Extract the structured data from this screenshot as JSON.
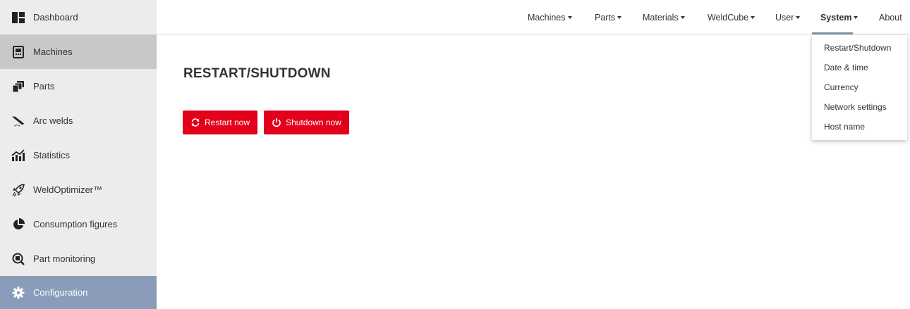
{
  "sidebar": {
    "items": [
      {
        "label": "Dashboard",
        "icon": "dashboard-icon"
      },
      {
        "label": "Machines",
        "icon": "machine-icon"
      },
      {
        "label": "Parts",
        "icon": "parts-icon"
      },
      {
        "label": "Arc welds",
        "icon": "arc-weld-icon"
      },
      {
        "label": "Statistics",
        "icon": "statistics-icon"
      },
      {
        "label": "WeldOptimizer™",
        "icon": "rocket-icon"
      },
      {
        "label": "Consumption figures",
        "icon": "pie-chart-icon"
      },
      {
        "label": "Part monitoring",
        "icon": "search-monitor-icon"
      },
      {
        "label": "Configuration",
        "icon": "gear-icon"
      }
    ],
    "selected_index": 1,
    "active_index": 8
  },
  "topnav": {
    "items": [
      "Machines",
      "Parts",
      "Materials",
      "WeldCube",
      "User",
      "System",
      "About"
    ],
    "active": "System"
  },
  "dropdown": {
    "items": [
      "Restart/Shutdown",
      "Date & time",
      "Currency",
      "Network settings",
      "Host name"
    ]
  },
  "main": {
    "title": "RESTART/SHUTDOWN",
    "restart_label": "Restart now",
    "shutdown_label": "Shutdown now"
  },
  "colors": {
    "accent_red": "#e2001a",
    "sidebar_bg": "#ececec",
    "sidebar_active": "#8a9cb9",
    "sidebar_selected": "#c8c8c8"
  }
}
